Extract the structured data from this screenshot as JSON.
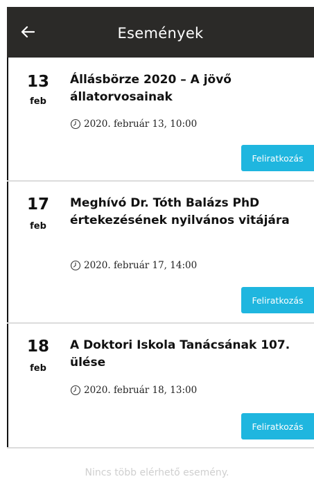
{
  "header": {
    "title": "Események",
    "back_icon": "arrow-left-icon"
  },
  "events": [
    {
      "day": "13",
      "month": "feb",
      "title": "Állásbörze 2020  – A jövő állatorvosainak",
      "time": "2020. február 13, 10:00",
      "button_label": "Feliratkozás"
    },
    {
      "day": "17",
      "month": "feb",
      "title": "Meghívó Dr. Tóth Balázs PhD értekezésének nyilvános vitájára",
      "time": "2020. február 17, 14:00",
      "button_label": "Feliratkozás"
    },
    {
      "day": "18",
      "month": "feb",
      "title": "A Doktori Iskola Tanácsának 107. ülése",
      "time": "2020. február 18, 13:00",
      "button_label": "Feliratkozás"
    }
  ],
  "footer": {
    "message": "Nincs több elérhető esemény."
  },
  "colors": {
    "header_bg": "#2b2a28",
    "button_bg": "#1fb6df",
    "footer_text": "#cfcfcf"
  }
}
